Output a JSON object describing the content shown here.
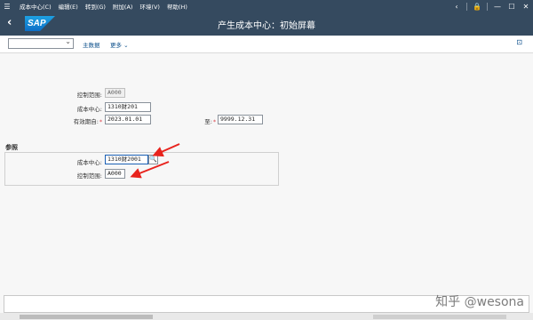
{
  "menubar": {
    "items": [
      "成本中心(C)",
      "编辑(E)",
      "转到(G)",
      "附加(A)",
      "环境(V)",
      "帮助(H)"
    ]
  },
  "titlebar": {
    "logo": "SAP",
    "title": "产生成本中心：初始屏幕"
  },
  "toolbar": {
    "dropdown_value": "",
    "master_data": "主数据",
    "more": "更多"
  },
  "form": {
    "controlling_area_label": "控制范围:",
    "controlling_area_value": "A000",
    "cost_center_label": "成本中心:",
    "cost_center_value": "1310财201",
    "valid_from_label": "有效期自:",
    "valid_from_value": "2023.01.01",
    "valid_to_label": "至:",
    "valid_to_value": "9999.12.31"
  },
  "reference": {
    "title": "参照",
    "cost_center_label": "成本中心:",
    "cost_center_value": "1310财2001",
    "controlling_area_label": "控制范围:",
    "controlling_area_value": "A000"
  },
  "watermark": "知乎 @wesona",
  "colors": {
    "shell": "#354a5f",
    "link": "#0a4e8a",
    "required": "#d9363e",
    "arrow": "#e8231d"
  }
}
